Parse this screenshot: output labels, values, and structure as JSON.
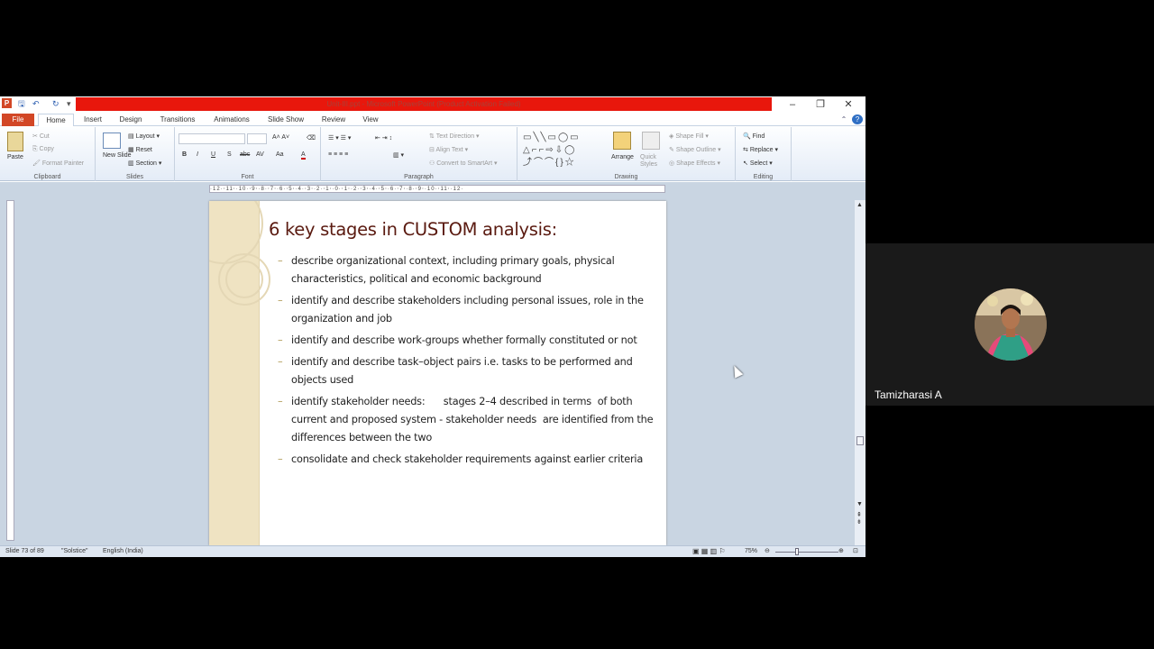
{
  "window": {
    "title": "Unit-III.ppt - Microsoft PowerPoint (Product Activation Failed)",
    "app_icon": "P"
  },
  "ribbon_tabs": [
    "File",
    "Home",
    "Insert",
    "Design",
    "Transitions",
    "Animations",
    "Slide Show",
    "Review",
    "View"
  ],
  "ribbon": {
    "clipboard": {
      "paste": "Paste",
      "cut": "Cut",
      "copy": "Copy",
      "format_painter": "Format Painter",
      "label": "Clipboard"
    },
    "slides": {
      "new_slide": "New Slide",
      "layout": "Layout",
      "reset": "Reset",
      "section": "Section",
      "label": "Slides"
    },
    "font": {
      "label": "Font",
      "bold": "B",
      "italic": "I",
      "underline": "U",
      "shadow": "S",
      "strike": "abc",
      "spacing": "AV",
      "case": "Aa",
      "color": "A"
    },
    "paragraph": {
      "text_direction": "Text Direction",
      "align_text": "Align Text",
      "smartart": "Convert to SmartArt",
      "label": "Paragraph"
    },
    "drawing": {
      "arrange": "Arrange",
      "quick_styles": "Quick Styles",
      "shape_fill": "Shape Fill",
      "shape_outline": "Shape Outline",
      "shape_effects": "Shape Effects",
      "label": "Drawing"
    },
    "editing": {
      "find": "Find",
      "replace": "Replace",
      "select": "Select",
      "label": "Editing"
    }
  },
  "ruler_text": "·12·⋅11⋅·10·⋅9⋅·8·⋅7⋅·6·⋅5⋅·4·⋅3⋅·2·⋅1⋅·0·⋅1⋅·2·⋅3⋅·4·⋅5⋅·6·⋅7⋅·8·⋅9⋅·10·⋅11⋅·12·",
  "slide": {
    "title": "6 key stages in CUSTOM analysis:",
    "bullets": [
      "describe organizational context, including primary goals,  physical characteristics, political and economic background",
      "identify and describe stakeholders including personal issues, role in the organization and job",
      "identify and describe work-groups whether formally constituted or not",
      "identify and describe task–object pairs i.e. tasks to be performed and objects used",
      "identify stakeholder needs:      stages 2–4 described in terms  of both current and proposed system - stakeholder needs  are identified from the differences between the two",
      "consolidate and check stakeholder requirements against earlier criteria"
    ],
    "bullet_marker": "–"
  },
  "statusbar": {
    "slide_info": "Slide 73 of 89",
    "theme": "\"Solstice\"",
    "language": "English (India)",
    "zoom": "75%"
  },
  "participant": {
    "name": "Tamizharasi A"
  },
  "colors": {
    "titlebar_red": "#e8170c",
    "file_tab": "#d24726",
    "slide_stripe": "#efe3c2",
    "title_text": "#5a1a10"
  }
}
